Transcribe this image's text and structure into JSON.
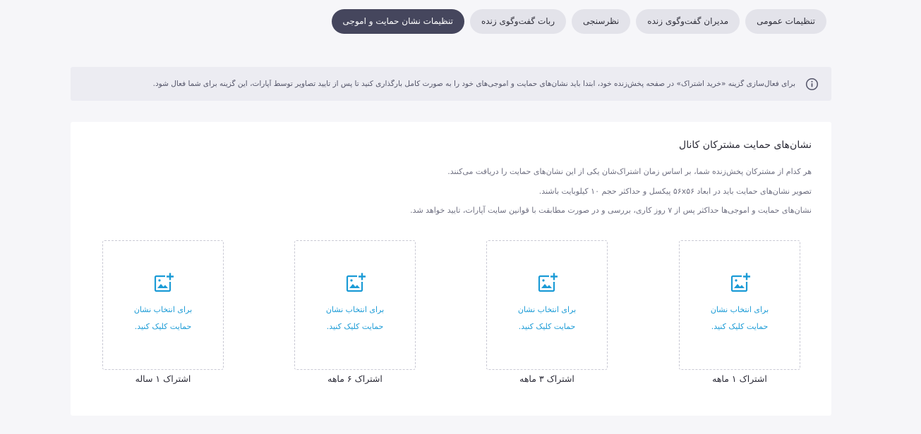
{
  "tabs": [
    {
      "label": "تنظیمات عمومی",
      "active": false
    },
    {
      "label": "مدیران گفت‌وگوی زنده",
      "active": false
    },
    {
      "label": "نظرسنجی",
      "active": false
    },
    {
      "label": "ربات گفت‌وگوی زنده",
      "active": false
    },
    {
      "label": "تنظیمات نشان حمایت و اموجی",
      "active": true
    }
  ],
  "alert": {
    "icon": "info-icon",
    "text": "برای فعال‌سازی گزینه «خرید اشتراک» در صفحه پخش‌زنده خود، ابتدا باید نشان‌های حمایت و اموجی‌های خود را به صورت کامل بارگذاری کنید تا پس از تایید تصاویر توسط آپارات، این گزینه برای شما فعال شود."
  },
  "card": {
    "title": "نشان‌های حمایت مشترکان کانال",
    "descriptions": [
      "هر کدام از مشترکان پخش‌زنده شما، بر اساس زمان اشتراک‌شان یکی از این نشان‌های حمایت را دریافت می‌کنند.",
      "تصویر نشان‌های حمایت باید در ابعاد ۵۶x۵۶ پیکسل و حداکثر حجم ۱۰ کیلوبایت باشند.",
      "نشان‌های حمایت و اموجی‌ها حداکثر پس از ۷ روز کاری، بررسی و در صورت مطابقت با قوانین سایت آپارات، تایید خواهد شد."
    ],
    "slots": [
      {
        "prompt": "برای انتخاب نشان\nحمایت کلیک کنید.",
        "label": "اشتراک ۱ ماهه"
      },
      {
        "prompt": "برای انتخاب نشان\nحمایت کلیک کنید.",
        "label": "اشتراک ۳ ماهه"
      },
      {
        "prompt": "برای انتخاب نشان\nحمایت کلیک کنید.",
        "label": "اشتراک ۶ ماهه"
      },
      {
        "prompt": "برای انتخاب نشان\nحمایت کلیک کنید.",
        "label": "اشتراک ۱ ساله"
      }
    ]
  },
  "colors": {
    "accent": "#1b9bd6",
    "active_tab": "#45465d",
    "tab_bg": "#e3e3ea",
    "page_bg": "#f6f6f9"
  }
}
